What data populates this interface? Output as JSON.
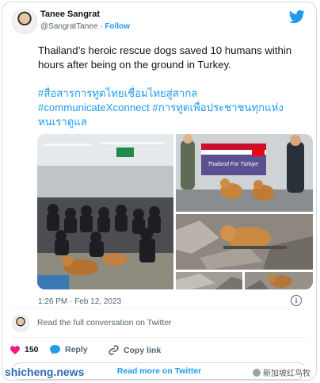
{
  "author": {
    "name": "Tanee Sangrat",
    "handle": "@SangratTanee",
    "separator": "·",
    "follow_label": "Follow"
  },
  "tweet": {
    "text": "Thailand’s heroic rescue dogs saved 10 humans within hours after being on the ground in Turkey.",
    "hashtags_line1": "#สื่อสารการทูตไทยเชื่อมไทยสู่สากล",
    "hashtags_line2": "#communicateXconnect #การทูตเพื่อประชาชนทุกแห่ง",
    "hashtags_line3": "หนเราดูแล"
  },
  "photos": {
    "banner_text": "Thailand For Türkiye"
  },
  "timestamp": "1:26 PM · Feb 12, 2023",
  "info_icon": "i",
  "read_full": "Read the full conversation on Twitter",
  "actions": {
    "likes": "150",
    "reply": "Reply",
    "copy_link": "Copy link"
  },
  "read_more": "Read more on Twitter",
  "watermarks": {
    "left": "shicheng.news",
    "right": "新加坡红鸟牧"
  },
  "icons": [
    "twitter-bird-icon",
    "info-icon",
    "heart-icon",
    "reply-icon",
    "link-icon"
  ],
  "colors": {
    "accent": "#1d9bf0",
    "like": "#f91880",
    "muted": "#536471"
  }
}
